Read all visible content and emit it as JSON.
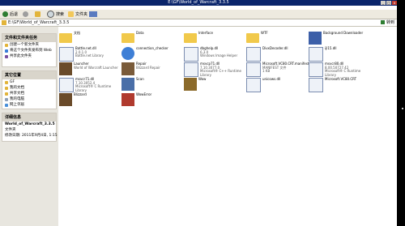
{
  "window": {
    "title": "E:\\GF\\World_of_Warcraft_3.3.5"
  },
  "toolbar": {
    "back_label": "后退",
    "search_label": "搜索",
    "folders_label": "文件夹"
  },
  "address": {
    "value": "E:\\GF\\World_of_Warcraft_3.3.5",
    "go_label": "转到"
  },
  "side": {
    "tasks": {
      "title": "文件和文件夹任务",
      "items": [
        "创建一个新文件夹",
        "将这个文件夹发布到 Web",
        "共享此文件夹"
      ]
    },
    "places": {
      "title": "其它位置",
      "items": [
        "GF",
        "我的文档",
        "共享文档",
        "我的电脑",
        "网上邻居"
      ]
    },
    "details": {
      "title": "详细信息",
      "lines": [
        "World_of_Warcraft_3.3.5",
        "文件夹",
        "修改日期: 2011年9月4日, 1:15"
      ]
    }
  },
  "files": [
    {
      "name": "文档",
      "type": "",
      "size": "",
      "kind": "folder"
    },
    {
      "name": "Data",
      "type": "",
      "size": "",
      "kind": "folder"
    },
    {
      "name": "Interface",
      "type": "",
      "size": "",
      "kind": "folder"
    },
    {
      "name": "WTF",
      "type": "",
      "size": "",
      "kind": "folder"
    },
    {
      "name": "Background Downloader",
      "type": "",
      "size": "",
      "kind": "bg"
    },
    {
      "name": "Battle.net.dll",
      "type": "2.0.1.0",
      "size": "Battle.net Library",
      "kind": "dll"
    },
    {
      "name": "connection_checker",
      "type": "",
      "size": "",
      "kind": "ie"
    },
    {
      "name": "dbghelp.dll",
      "type": "6.3.0",
      "size": "Windows Image Helper",
      "kind": "dll"
    },
    {
      "name": "DivxDecoder.dll",
      "type": "",
      "size": "",
      "kind": "dll"
    },
    {
      "name": "ijl15.dll",
      "type": "",
      "size": "",
      "kind": "dll"
    },
    {
      "name": "Launcher",
      "type": "",
      "size": "World of Warcraft Launcher",
      "kind": "wow"
    },
    {
      "name": "Repair",
      "type": "",
      "size": "Blizzard Repair",
      "kind": "repair"
    },
    {
      "name": "msvcp71.dll",
      "type": "7.10.3077.0",
      "size": "Microsoft® C++ Runtime Library",
      "kind": "dll"
    },
    {
      "name": "Microsoft.VC80.CRT.manifest",
      "type": "MANIFEST 文件",
      "size": "1 KB",
      "kind": "dll"
    },
    {
      "name": "msvcr80.dll",
      "type": "8.00.50727.42",
      "size": "Microsoft® C Runtime Library",
      "kind": "dll"
    },
    {
      "name": "msvcr71.dll",
      "type": "7.10.3052.4",
      "size": "Microsoft® C Runtime Library",
      "kind": "dll"
    },
    {
      "name": "Scan",
      "type": "",
      "size": "",
      "kind": "scan"
    },
    {
      "name": "Wow",
      "type": "",
      "size": "",
      "kind": "wowexe"
    },
    {
      "name": "unicows.dll",
      "type": "",
      "size": "",
      "kind": "dll"
    },
    {
      "name": "Microsoft.VC80.CRT",
      "type": "",
      "size": "",
      "kind": "dll"
    },
    {
      "name": "Blizzard",
      "type": "",
      "size": "",
      "kind": "wow"
    },
    {
      "name": "WowError",
      "type": "",
      "size": "",
      "kind": "wowerror"
    }
  ],
  "status": {
    "bg": "#000000"
  }
}
